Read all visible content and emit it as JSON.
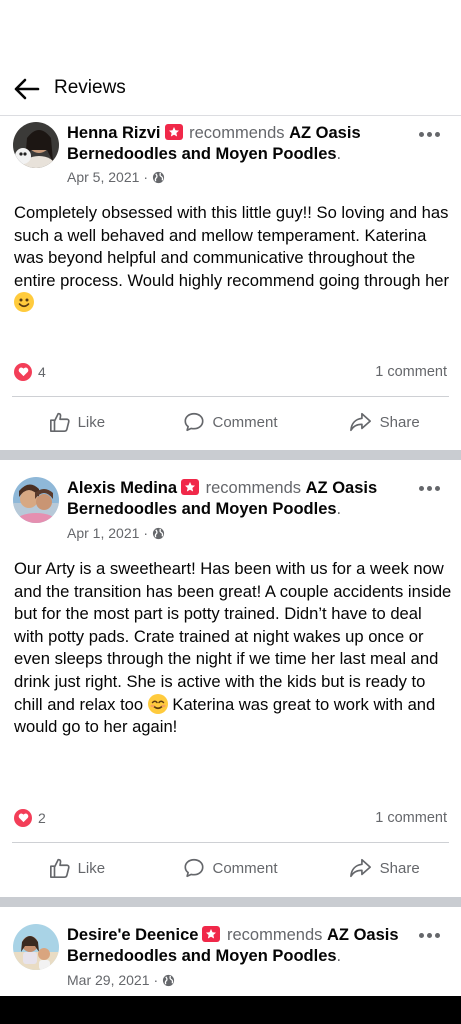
{
  "header": {
    "title": "Reviews"
  },
  "posts": [
    {
      "author": "Henna Rizvi",
      "recommends": "recommends",
      "page": "AZ Oasis Bernedoodles and  Moyen Poodles",
      "date": "Apr 5, 2021",
      "text": "Completely obsessed with this little guy!! So loving and has such a well behaved and mellow temperament. Katerina was beyond helpful and communicative throughout the entire process. Would highly recommend going through her",
      "reaction_count": "4",
      "comment_count": "1 comment"
    },
    {
      "author": "Alexis Medina",
      "recommends": "recommends",
      "page": "AZ Oasis Bernedoodles and  Moyen Poodles",
      "date": "Apr 1, 2021",
      "text_before_emoji": "Our Arty is a sweetheart! Has been with us for a week now and the transition has been great! A couple accidents inside but for the most part is potty trained. Didn’t have to deal with potty pads. Crate trained at night wakes up once or even sleeps through the night if we time her last meal and drink just right. She is active with the kids but is ready to chill and relax too",
      "text_after_emoji": "Katerina was great to work with and would go to her again!",
      "reaction_count": "2",
      "comment_count": "1 comment"
    },
    {
      "author": "Desire'e Deenice",
      "recommends": "recommends",
      "page": "AZ Oasis Bernedoodles and  Moyen Poodles",
      "date": "Mar 29, 2021"
    }
  ],
  "actions": {
    "like": "Like",
    "comment": "Comment",
    "share": "Share"
  },
  "icons": {
    "back": "back-arrow-icon",
    "more": "more-options-icon",
    "globe": "globe-icon",
    "badge": "recommends-badge-icon",
    "love": "love-reaction-icon",
    "like": "thumbs-up-icon",
    "comment": "comment-bubble-icon",
    "share": "share-arrow-icon"
  },
  "colors": {
    "badge": "#f02849",
    "love": "#f33e58",
    "secondary_text": "#65676b",
    "separator": "#c9ccd1"
  }
}
